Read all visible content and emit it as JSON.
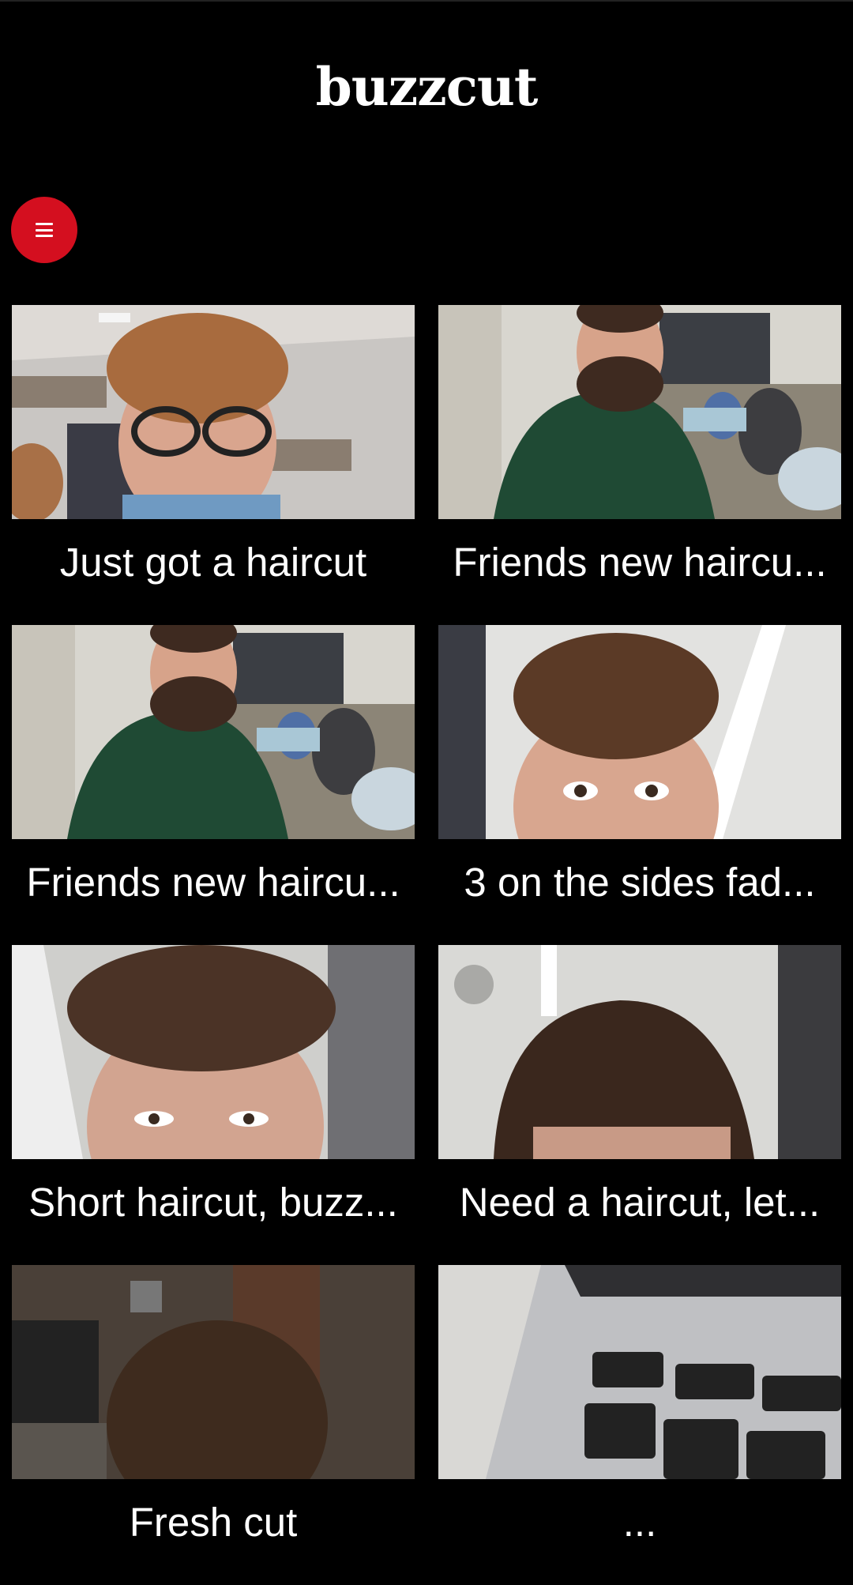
{
  "app": {
    "title": "buzzcut"
  },
  "menu": {
    "icon": "hamburger-menu-icon",
    "color": "#d40f1f"
  },
  "posts": [
    {
      "caption": "Just got a haircut"
    },
    {
      "caption": "Friends new haircu..."
    },
    {
      "caption": "Friends new haircu..."
    },
    {
      "caption": "3 on the sides fad..."
    },
    {
      "caption": "Short haircut, buzz..."
    },
    {
      "caption": "Need a haircut, let..."
    },
    {
      "caption": "Fresh cut"
    },
    {
      "caption": "..."
    }
  ]
}
